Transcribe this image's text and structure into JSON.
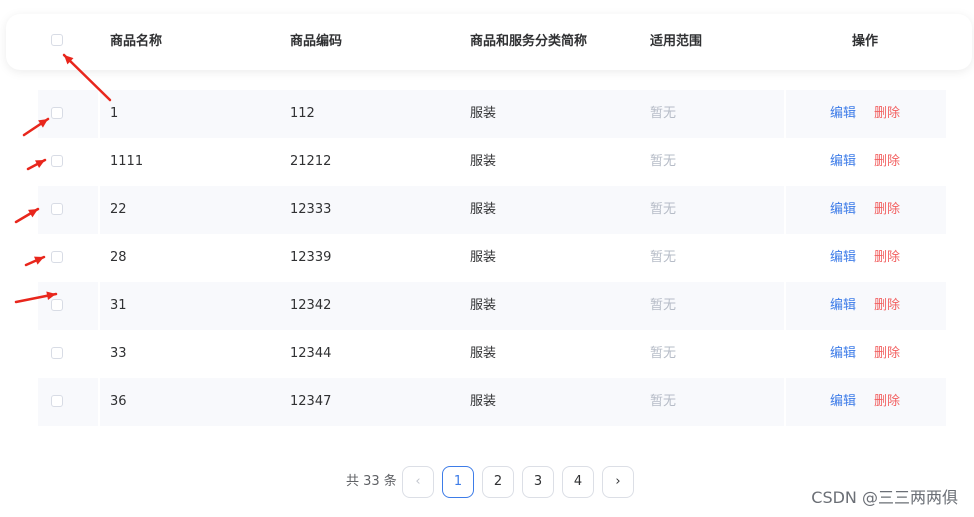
{
  "table": {
    "headers": {
      "name": "商品名称",
      "code": "商品编码",
      "category": "商品和服务分类简称",
      "scope": "适用范围",
      "actions": "操作"
    },
    "rows": [
      {
        "name": "1",
        "code": "112",
        "category": "服装",
        "scope": "暂无",
        "edit": "编辑",
        "delete": "删除"
      },
      {
        "name": "1111",
        "code": "21212",
        "category": "服装",
        "scope": "暂无",
        "edit": "编辑",
        "delete": "删除"
      },
      {
        "name": "22",
        "code": "12333",
        "category": "服装",
        "scope": "暂无",
        "edit": "编辑",
        "delete": "删除"
      },
      {
        "name": "28",
        "code": "12339",
        "category": "服装",
        "scope": "暂无",
        "edit": "编辑",
        "delete": "删除"
      },
      {
        "name": "31",
        "code": "12342",
        "category": "服装",
        "scope": "暂无",
        "edit": "编辑",
        "delete": "删除"
      },
      {
        "name": "33",
        "code": "12344",
        "category": "服装",
        "scope": "暂无",
        "edit": "编辑",
        "delete": "删除"
      },
      {
        "name": "36",
        "code": "12347",
        "category": "服装",
        "scope": "暂无",
        "edit": "编辑",
        "delete": "删除"
      }
    ]
  },
  "pagination": {
    "total": "共 33 条",
    "prev": "‹",
    "next": "›",
    "pages": [
      "1",
      "2",
      "3",
      "4"
    ],
    "current": "1"
  },
  "annotations": {
    "arrow_color": "#e8261c"
  },
  "watermark": "CSDN @三三两两俱"
}
